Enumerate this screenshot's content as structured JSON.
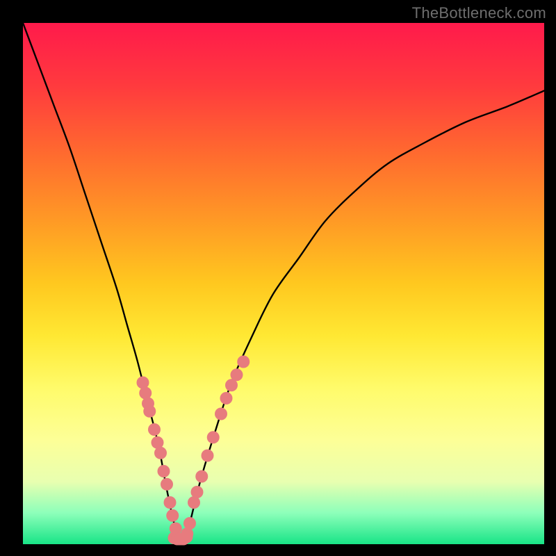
{
  "watermark": "TheBottleneck.com",
  "chart_data": {
    "type": "line",
    "title": "",
    "xlabel": "",
    "ylabel": "",
    "ylim": [
      0,
      100
    ],
    "xlim": [
      0,
      100
    ],
    "series": [
      {
        "name": "bottleneck-curve",
        "x": [
          0,
          3,
          6,
          9,
          12,
          15,
          18,
          20,
          22,
          24,
          26,
          27.5,
          29,
          30,
          31,
          32,
          34,
          37,
          40,
          44,
          48,
          53,
          58,
          64,
          70,
          77,
          85,
          93,
          100
        ],
        "values": [
          100,
          92,
          84,
          76,
          67,
          58,
          49,
          42,
          35,
          27,
          19,
          11,
          4,
          1,
          1,
          4,
          12,
          22,
          31,
          40,
          48,
          55,
          62,
          68,
          73,
          77,
          81,
          84,
          87
        ]
      }
    ],
    "markers_left": {
      "name": "datapoints-left",
      "color": "#e77b7e",
      "x": [
        23.0,
        23.5,
        24.0,
        24.3,
        25.2,
        25.8,
        26.4,
        27.0,
        27.6,
        28.2,
        28.7,
        29.3,
        30.0,
        30.6
      ],
      "values": [
        31.0,
        29.0,
        27.0,
        25.5,
        22.0,
        19.5,
        17.5,
        14.0,
        11.5,
        8.0,
        5.5,
        3.0,
        1.0,
        1.0
      ]
    },
    "markers_right": {
      "name": "datapoints-right",
      "color": "#e77b7e",
      "x": [
        31.5,
        32.0,
        32.8,
        33.4,
        34.3,
        35.4,
        36.5,
        38.0,
        39.0,
        40.0,
        41.0,
        42.3
      ],
      "values": [
        2.0,
        4.0,
        8.0,
        10.0,
        13.0,
        17.0,
        20.5,
        25.0,
        28.0,
        30.5,
        32.5,
        35.0
      ]
    },
    "bottom_blob": {
      "name": "datapoints-bottom",
      "color": "#e77b7e",
      "x": [
        29.0,
        29.6,
        30.2,
        30.8,
        31.4
      ],
      "values": [
        1.2,
        1.0,
        1.0,
        1.0,
        1.4
      ]
    },
    "background_gradient": {
      "top": "#ff1a4b",
      "mid": "#ffe833",
      "bottom": "#18e487"
    }
  }
}
